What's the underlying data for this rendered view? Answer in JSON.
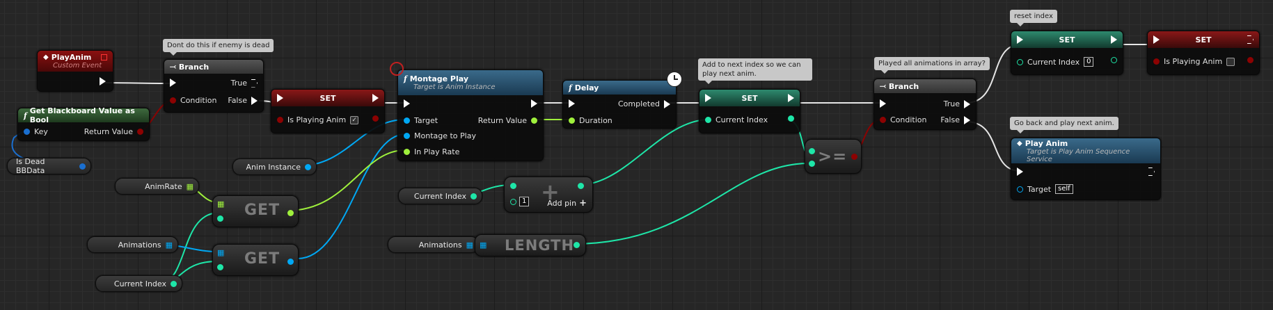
{
  "comments": {
    "enemy_dead": "Dont do this if enemy is dead",
    "next_index": "Add to next index so we can play next anim.",
    "played_all": "Played all animations in array?",
    "reset_index": "reset index",
    "go_back": "Go back and play next anim."
  },
  "nodes": {
    "play_anim_event": {
      "title": "PlayAnim",
      "subtitle": "Custom Event"
    },
    "branch1": {
      "title": "Branch",
      "true": "True",
      "false": "False",
      "condition": "Condition"
    },
    "get_bb": {
      "title": "Get Blackboard Value as Bool",
      "key": "Key",
      "return": "Return Value"
    },
    "set1": {
      "title": "SET",
      "var": "Is Playing Anim",
      "checked": "✓"
    },
    "montage": {
      "title": "Montage Play",
      "subtitle": "Target is Anim Instance",
      "target": "Target",
      "montage": "Montage to Play",
      "rate": "In Play Rate",
      "return": "Return Value"
    },
    "delay": {
      "title": "Delay",
      "completed": "Completed",
      "duration": "Duration"
    },
    "set2": {
      "title": "SET",
      "var": "Current Index"
    },
    "branch2": {
      "title": "Branch",
      "true": "True",
      "false": "False",
      "condition": "Condition"
    },
    "set3": {
      "title": "SET",
      "var": "Current Index",
      "value": "0"
    },
    "set4": {
      "title": "SET",
      "var": "Is Playing Anim"
    },
    "play_anim_call": {
      "title": "Play Anim",
      "subtitle": "Target is Play Anim Sequence Service",
      "target": "Target",
      "target_value": "self"
    },
    "add": {
      "value": "1",
      "add_pin": "Add pin"
    },
    "get1": {
      "label": "GET"
    },
    "get2": {
      "label": "GET"
    },
    "length": {
      "label": "LENGTH"
    },
    "compare": {
      "label": ">="
    }
  },
  "variables": {
    "is_dead_bb": "Is Dead BBData",
    "anim_instance": "Anim Instance",
    "anim_rate": "AnimRate",
    "animations1": "Animations",
    "current_index1": "Current Index",
    "current_index2": "Current Index",
    "animations2": "Animations"
  },
  "colors": {
    "exec": "#ffffff",
    "bool": "#8c0202",
    "object": "#00a8f4",
    "float": "#9ff03c",
    "int": "#1ee6a8",
    "event_header": "#8a1010",
    "function_header": "#2e5a7a",
    "set_header": "#333333",
    "branch_header": "#555555"
  }
}
